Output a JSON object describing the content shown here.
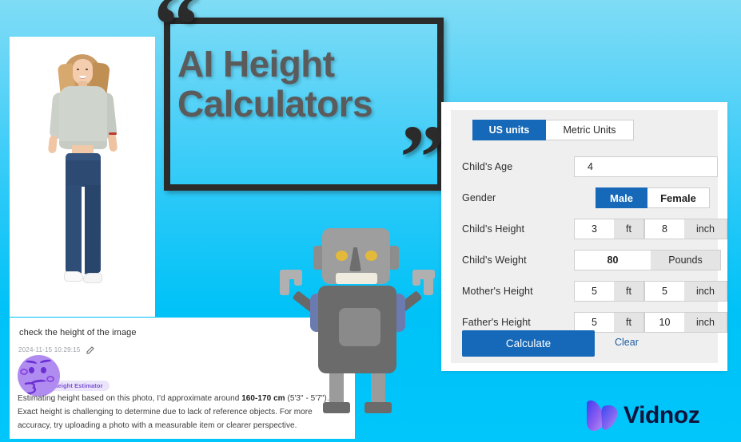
{
  "background": {
    "gradient_top": "#7fdcf5",
    "gradient_bottom": "#00c6fb"
  },
  "headline": {
    "line1": "AI Height",
    "line2": "Calculators",
    "quote_open": "“",
    "quote_close": "”",
    "color": "#5b5b5b"
  },
  "chat": {
    "question": "check the height of the image",
    "timestamp": "2024-11-15 10:29:15",
    "edit_icon": "pencil-icon",
    "avatar_icon": "thinking-face-emoji",
    "badge": "Height Estimator",
    "answer_part1": "Estimating height based on this photo, I'd approximate around ",
    "answer_bold": "160-170 cm",
    "answer_part2": " (5'3\" - 5'7\"). Exact height is challenging to determine due to lack of reference objects. For more accuracy, try uploading a photo with a measurable item or clearer perspective."
  },
  "calculator": {
    "accent_color": "#1668b8",
    "tabs": [
      {
        "label": "US units",
        "active": true
      },
      {
        "label": "Metric Units",
        "active": false
      }
    ],
    "rows": [
      {
        "label": "Child's Age",
        "type": "single",
        "value": "4"
      },
      {
        "label": "Gender",
        "type": "segment",
        "options": [
          "Male",
          "Female"
        ],
        "selected": "Male"
      },
      {
        "label": "Child's Height",
        "type": "ft_in",
        "feet": "3",
        "feet_unit": "ft",
        "inches": "8",
        "inches_unit": "inch"
      },
      {
        "label": "Child's Weight",
        "type": "weight",
        "value": "80",
        "unit": "Pounds"
      },
      {
        "label": "Mother's Height",
        "type": "ft_in",
        "feet": "5",
        "feet_unit": "ft",
        "inches": "5",
        "inches_unit": "inch"
      },
      {
        "label": "Father's Height",
        "type": "ft_in",
        "feet": "5",
        "feet_unit": "ft",
        "inches": "10",
        "inches_unit": "inch"
      }
    ],
    "calculate_label": "Calculate",
    "clear_label": "Clear"
  },
  "robot": {
    "icon": "robot-illustration",
    "eye_color": "#e2b93b",
    "body_color": "#6b6b6b"
  },
  "photo": {
    "icon": "woman-full-body-photo"
  },
  "logo": {
    "text": "Vidnoz",
    "icon": "vidnoz-v-logo",
    "brand_color": "#10143c"
  }
}
